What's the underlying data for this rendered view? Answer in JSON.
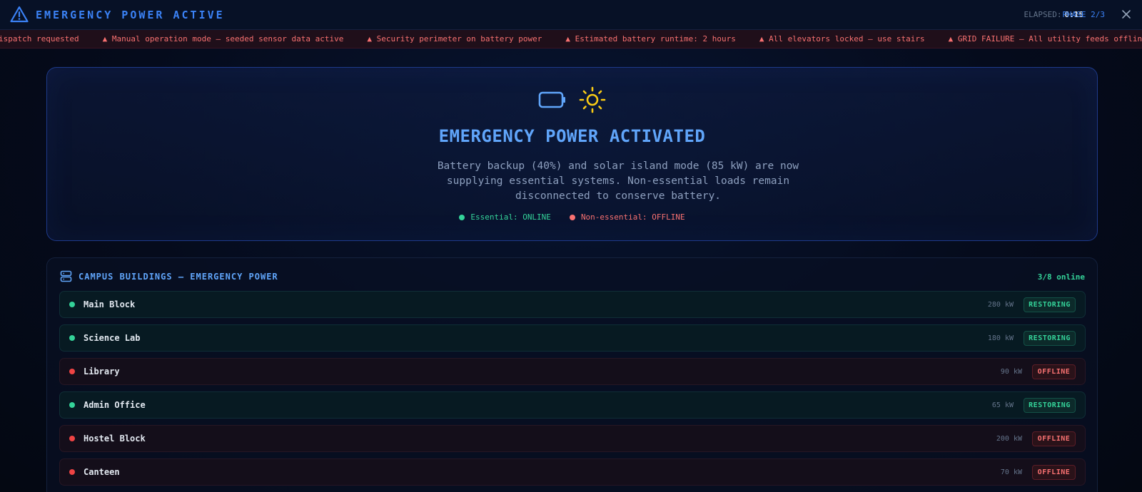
{
  "header": {
    "title": "EMERGENCY POWER ACTIVE",
    "elapsed_label": "ELAPSED:",
    "elapsed_value": "0:15",
    "phase": "PHASE 2/3"
  },
  "ticker": {
    "items": [
      "ispatch requested",
      "▲ Manual operation mode — seeded sensor data active",
      "▲ Security perimeter on battery power",
      "▲ Estimated battery runtime: 2 hours",
      "▲ All elevators locked — use stairs",
      "▲ GRID FAILURE — All utility feeds offline"
    ]
  },
  "hero": {
    "title": "EMERGENCY POWER ACTIVATED",
    "description": "Battery backup (40%) and solar island mode (85 kW) are now supplying essential systems. Non-essential loads remain disconnected to conserve battery.",
    "essential": "Essential: ONLINE",
    "non_essential": "Non-essential: OFFLINE"
  },
  "buildings": {
    "title": "CAMPUS BUILDINGS — EMERGENCY POWER",
    "count": "3/8 online",
    "rows": [
      {
        "name": "Main Block",
        "kw": "280 kW",
        "status": "RESTORING"
      },
      {
        "name": "Science Lab",
        "kw": "180 kW",
        "status": "RESTORING"
      },
      {
        "name": "Library",
        "kw": "90 kW",
        "status": "OFFLINE"
      },
      {
        "name": "Admin Office",
        "kw": "65 kW",
        "status": "RESTORING"
      },
      {
        "name": "Hostel Block",
        "kw": "200 kW",
        "status": "OFFLINE"
      },
      {
        "name": "Canteen",
        "kw": "70 kW",
        "status": "OFFLINE"
      }
    ]
  },
  "colors": {
    "accent": "#3b82f6",
    "online": "#34d399",
    "offline": "#f87171",
    "solar": "#facc15"
  },
  "icons": [
    "warning-triangle-icon",
    "close-icon",
    "battery-icon",
    "sun-icon",
    "server-stack-icon"
  ]
}
